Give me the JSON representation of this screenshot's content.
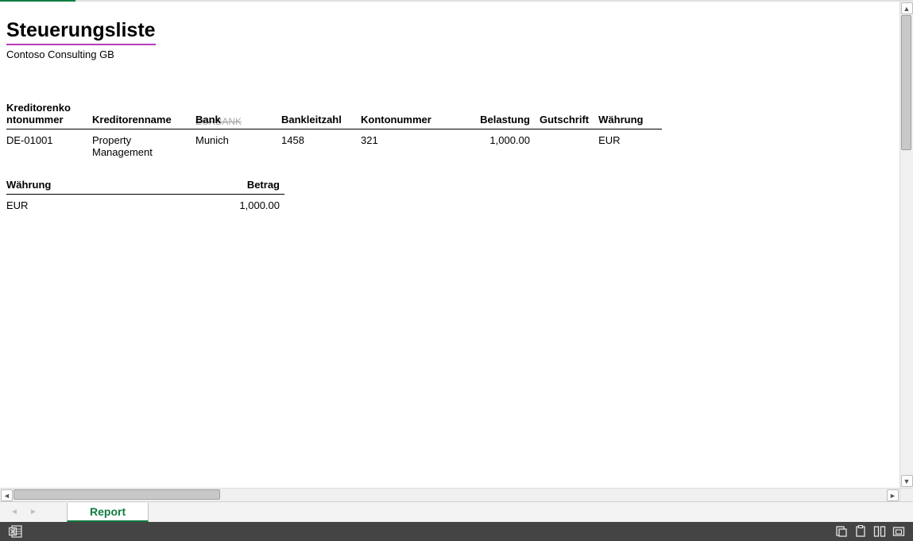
{
  "report": {
    "title": "Steuerungsliste",
    "company": "Contoso Consulting GB"
  },
  "main_table": {
    "headers": {
      "kreditorenkontonummer": "Kreditorenko\nntonummer",
      "kreditorenname": "Kreditorenname",
      "bank": "Bank",
      "bankleitzahl": "Bankleitzahl",
      "kontonummer": "Kontonummer",
      "belastung": "Belastung",
      "gutschrift": "Gutschrift",
      "waehrung": "Währung"
    },
    "rows": [
      {
        "kreditorenkontonummer": "DE-01001",
        "kreditorenname": "Property Management",
        "bank": "Munich",
        "bank_ghost": "EURBANK",
        "bankleitzahl": "1458",
        "kontonummer": "321",
        "belastung": "1,000.00",
        "gutschrift": "",
        "waehrung": "EUR"
      }
    ]
  },
  "summary_table": {
    "headers": {
      "waehrung": "Währung",
      "betrag": "Betrag"
    },
    "rows": [
      {
        "waehrung": "EUR",
        "betrag": "1,000.00"
      }
    ]
  },
  "tabstrip": {
    "active_tab": "Report"
  },
  "icons": {
    "excel": "excel-logo",
    "copy": "copy-icon",
    "clipboard": "clipboard-icon",
    "page_layout": "page-layout-icon",
    "fullscreen": "fullscreen-icon"
  }
}
